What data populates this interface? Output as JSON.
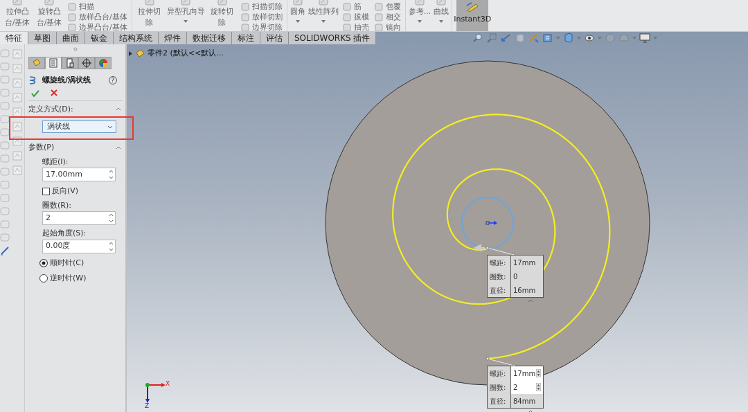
{
  "ribbon": {
    "groups": [
      {
        "items": [
          {
            "kind": "large",
            "label": "拉伸凸台/基体",
            "caret": false
          },
          {
            "kind": "large",
            "label": "旋转凸台/基体",
            "caret": false
          },
          {
            "kind": "stack",
            "labels": [
              "扫描",
              "放样凸台/基体",
              "边界凸台/基体"
            ]
          }
        ]
      },
      {
        "items": [
          {
            "kind": "large",
            "label": "拉伸切除",
            "caret": false
          },
          {
            "kind": "wide",
            "label": "异型孔向导",
            "caret": true
          },
          {
            "kind": "large",
            "label": "旋转切除",
            "caret": false
          },
          {
            "kind": "stack",
            "labels": [
              "扫描切除",
              "放样切割",
              "边界切除"
            ]
          }
        ]
      },
      {
        "items": [
          {
            "kind": "wide",
            "label": "圆角",
            "caret": true
          },
          {
            "kind": "wide",
            "label": "线性阵列",
            "caret": true
          },
          {
            "kind": "stack",
            "labels": [
              "筋",
              "拔模",
              "抽壳"
            ]
          },
          {
            "kind": "stack",
            "labels": [
              "包覆",
              "相交",
              "镜向"
            ]
          }
        ]
      },
      {
        "items": [
          {
            "kind": "wide",
            "label": "参考...",
            "caret": true
          },
          {
            "kind": "wide",
            "label": "曲线",
            "caret": true
          }
        ]
      }
    ],
    "instant3d": {
      "label": "Instant3D",
      "selected": true
    }
  },
  "tabs": [
    {
      "label": "特征",
      "selected": true
    },
    {
      "label": "草图",
      "selected": false
    },
    {
      "label": "曲面",
      "selected": false
    },
    {
      "label": "钣金",
      "selected": false
    },
    {
      "label": "结构系统",
      "selected": false
    },
    {
      "label": "焊件",
      "selected": false
    },
    {
      "label": "数据迁移",
      "selected": false
    },
    {
      "label": "标注",
      "selected": false
    },
    {
      "label": "评估",
      "selected": false
    },
    {
      "label": "SOLIDWORKS 插件",
      "selected": false
    }
  ],
  "tree": {
    "label": "零件2  (默认<<默认..."
  },
  "property_manager": {
    "tabs": [
      {
        "kind": "feature",
        "selected": false
      },
      {
        "kind": "property",
        "selected": true
      },
      {
        "kind": "config",
        "selected": false
      },
      {
        "kind": "dimxpert",
        "selected": false
      },
      {
        "kind": "display",
        "selected": false
      }
    ],
    "title": "螺旋线/涡状线",
    "help": "?",
    "sections": [
      {
        "title": "定义方式(D):",
        "expanded": true,
        "fields": [
          {
            "kind": "select",
            "value": "涡状线",
            "highlighted": true
          }
        ]
      },
      {
        "title": "参数(P)",
        "expanded": true,
        "fields": [
          {
            "kind": "spin",
            "label": "螺距(I):",
            "value": "17.00mm"
          },
          {
            "kind": "checkbox",
            "label": "反向(V)",
            "checked": false
          },
          {
            "kind": "spin",
            "label": "圈数(R):",
            "value": "2"
          },
          {
            "kind": "spin",
            "label": "起始角度(S):",
            "value": "0.00度"
          },
          {
            "kind": "radio",
            "label": "顺时针(C)",
            "selected": true
          },
          {
            "kind": "radio",
            "label": "逆时针(W)",
            "selected": false
          }
        ]
      }
    ]
  },
  "callouts": [
    {
      "rows": [
        {
          "label": "螺距:",
          "value": "17mm",
          "kind": "plain"
        },
        {
          "label": "圈数:",
          "value": "0",
          "kind": "plain"
        },
        {
          "label": "直径:",
          "value": "16mm",
          "kind": "plain"
        }
      ]
    },
    {
      "rows": [
        {
          "label": "螺距:",
          "value": "17mm",
          "kind": "spin"
        },
        {
          "label": "圈数:",
          "value": "2",
          "kind": "spin"
        },
        {
          "label": "直径:",
          "value": "84mm",
          "kind": "plain"
        }
      ]
    }
  ],
  "triad": {
    "x_label": "X",
    "z_label": "Z"
  }
}
